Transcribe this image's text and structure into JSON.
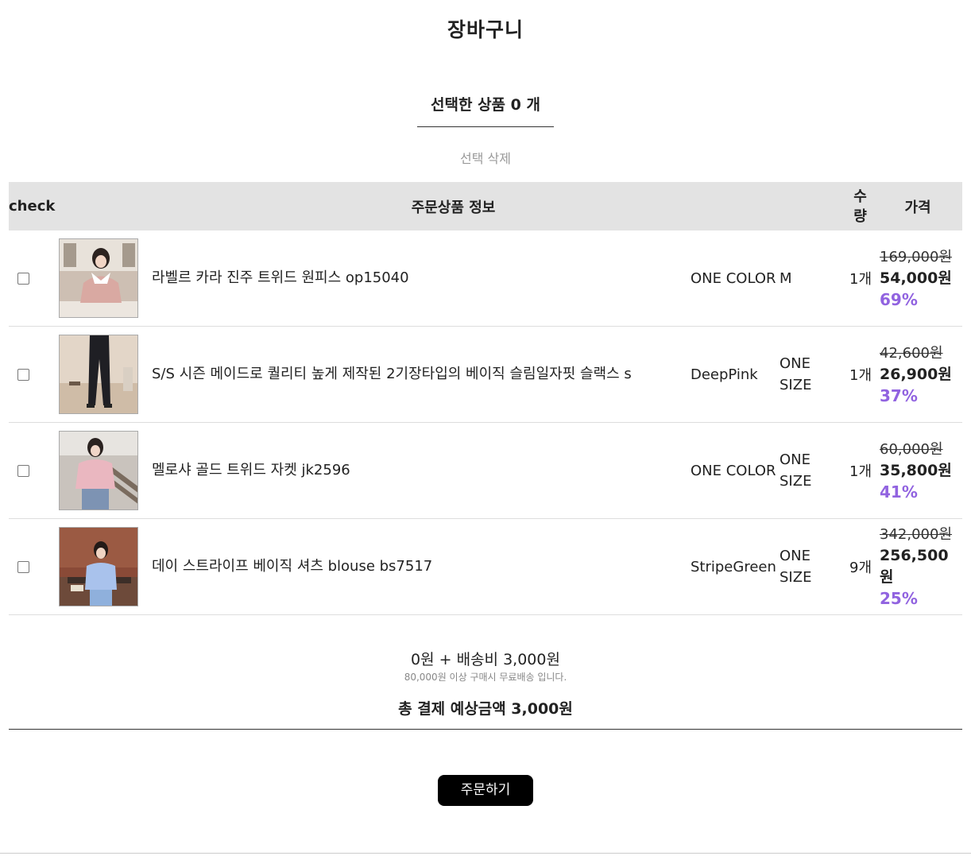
{
  "header": {
    "title": "장바구니"
  },
  "selection": {
    "label": "선택한 상품 0 개",
    "delete_label": "선택 삭제"
  },
  "table": {
    "col_check": "check",
    "col_info": "주문상품 정보",
    "col_qty_1": "수",
    "col_qty_2": "량",
    "col_price": "가격"
  },
  "items": [
    {
      "name": "라벨르 카라 진주 트위드 원피스 op15040",
      "color": "ONE COLOR",
      "size": "M",
      "qty": "1개",
      "original_price": "169,000원",
      "sale_price": "54,000원",
      "discount": "69%"
    },
    {
      "name": "S/S 시즌 메이드로 퀄리티 높게 제작된 2기장타입의 베이직 슬림일자핏 슬랙스 s",
      "color": "DeepPink",
      "size": "ONE SIZE",
      "qty": "1개",
      "original_price": "42,600원",
      "sale_price": "26,900원",
      "discount": "37%"
    },
    {
      "name": "멜로샤 골드 트위드 자켓 jk2596",
      "color": "ONE COLOR",
      "size": "ONE SIZE",
      "qty": "1개",
      "original_price": "60,000원",
      "sale_price": "35,800원",
      "discount": "41%"
    },
    {
      "name": "데이 스트라이프 베이직 셔츠 blouse bs7517",
      "color": "StripeGreen",
      "size": "ONE SIZE",
      "qty": "9개",
      "original_price": "342,000원",
      "sale_price": "256,500원",
      "discount": "25%"
    }
  ],
  "summary": {
    "line": "0원 + 배송비 3,000원",
    "shipping_note": "80,000원 이상 구매시 무료배송 입니다.",
    "total": "총 결제 예상금액 3,000원"
  },
  "order_button": {
    "label": "주문하기"
  },
  "colors": {
    "discount": "#9163e0",
    "header_bg": "#e3e3e3",
    "button_bg": "#000000"
  }
}
